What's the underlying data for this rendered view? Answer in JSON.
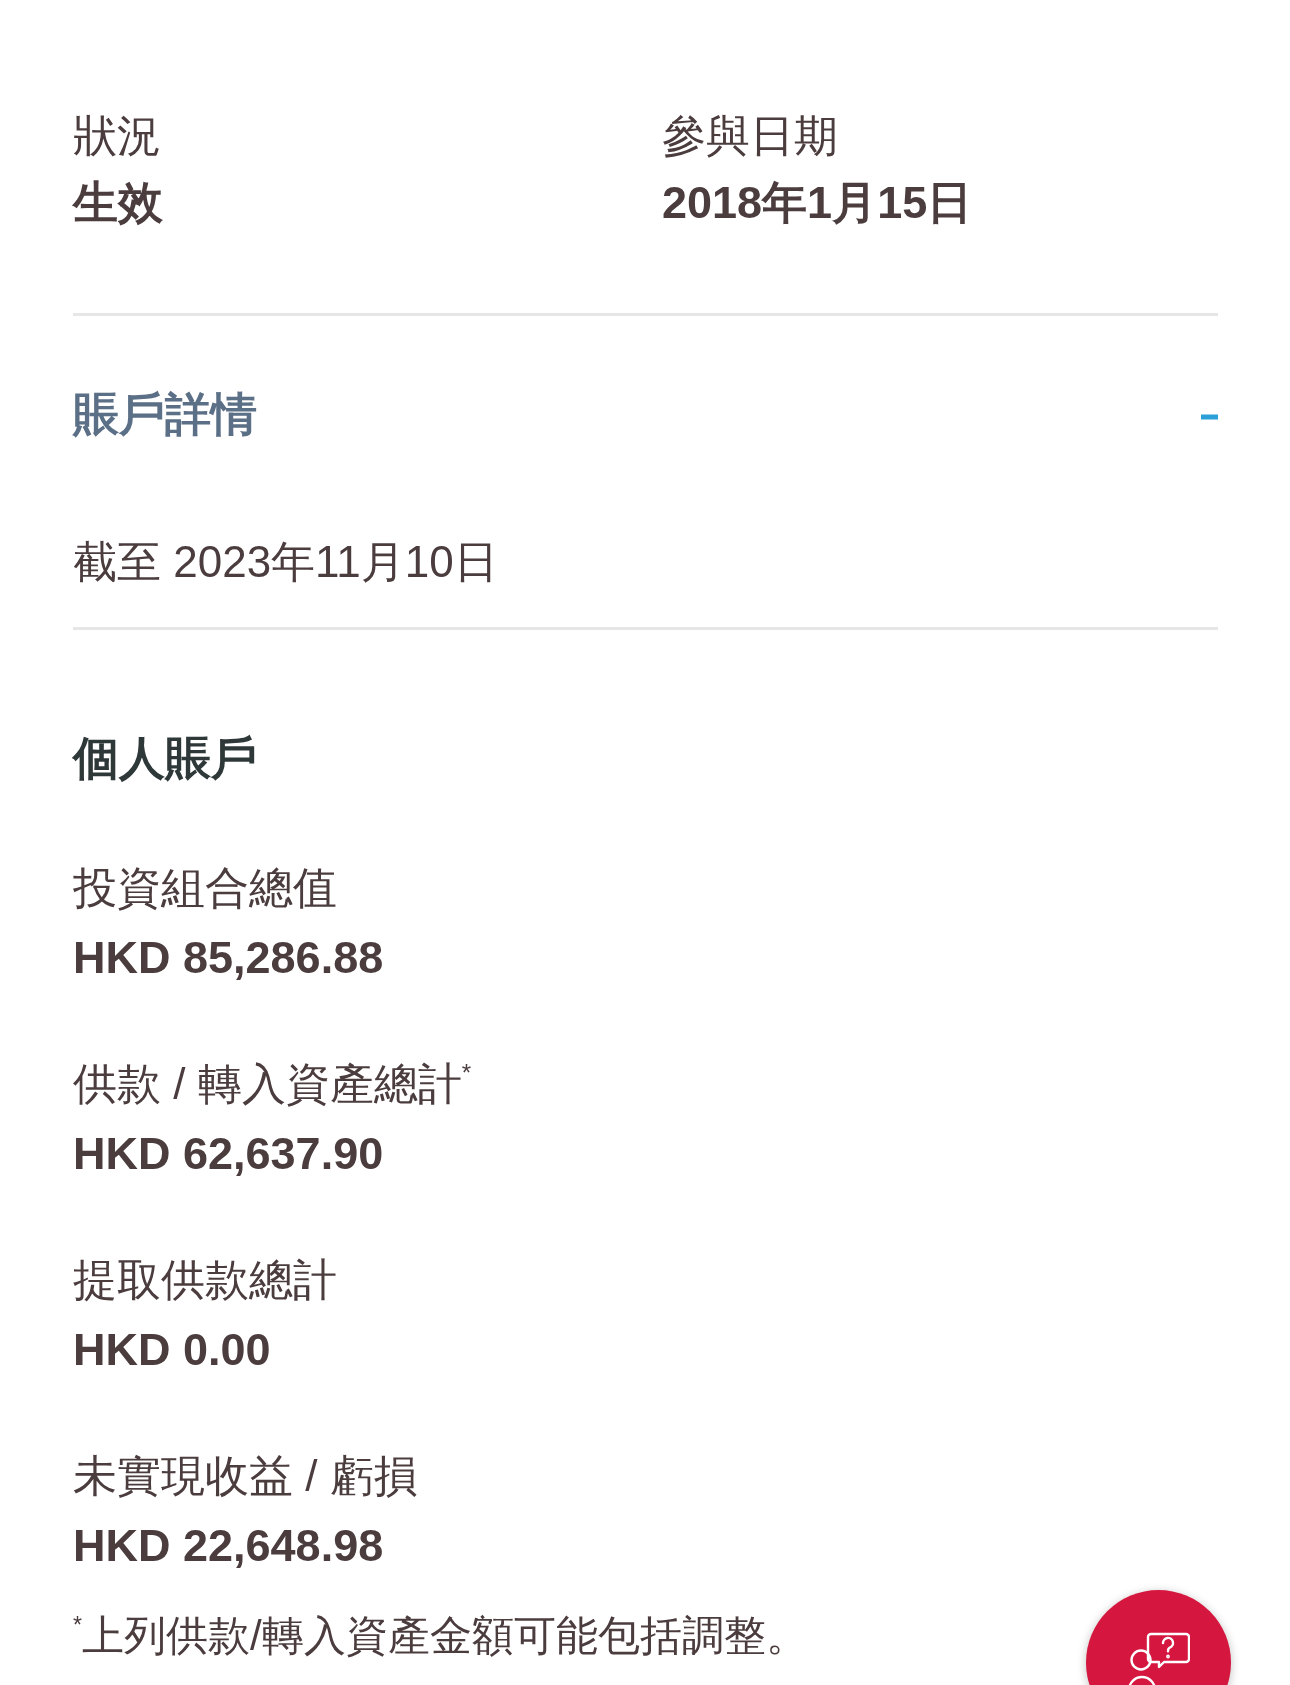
{
  "summary": [
    {
      "label": "狀況",
      "value": "生效"
    },
    {
      "label": "參與日期",
      "value": "2018年1月15日"
    }
  ],
  "account_details": {
    "title": "賬戶詳情",
    "expanded": true,
    "as_of": "截至 2023年11月10日"
  },
  "personal_account": {
    "title": "個人賬戶",
    "items": [
      {
        "label": "投資組合總值",
        "value": "HKD 85,286.88"
      },
      {
        "label": "供款 / 轉入資產總計$^{*}$",
        "value": "HKD 62,637.90"
      },
      {
        "label": "提取供款總計",
        "value": "HKD 0.00"
      },
      {
        "label": "未實現收益 / 虧損",
        "value": "HKD 22,648.98"
      }
    ]
  },
  "footnote": "$^{*}$上列供款/轉入資產金額可能包括調整。"
}
